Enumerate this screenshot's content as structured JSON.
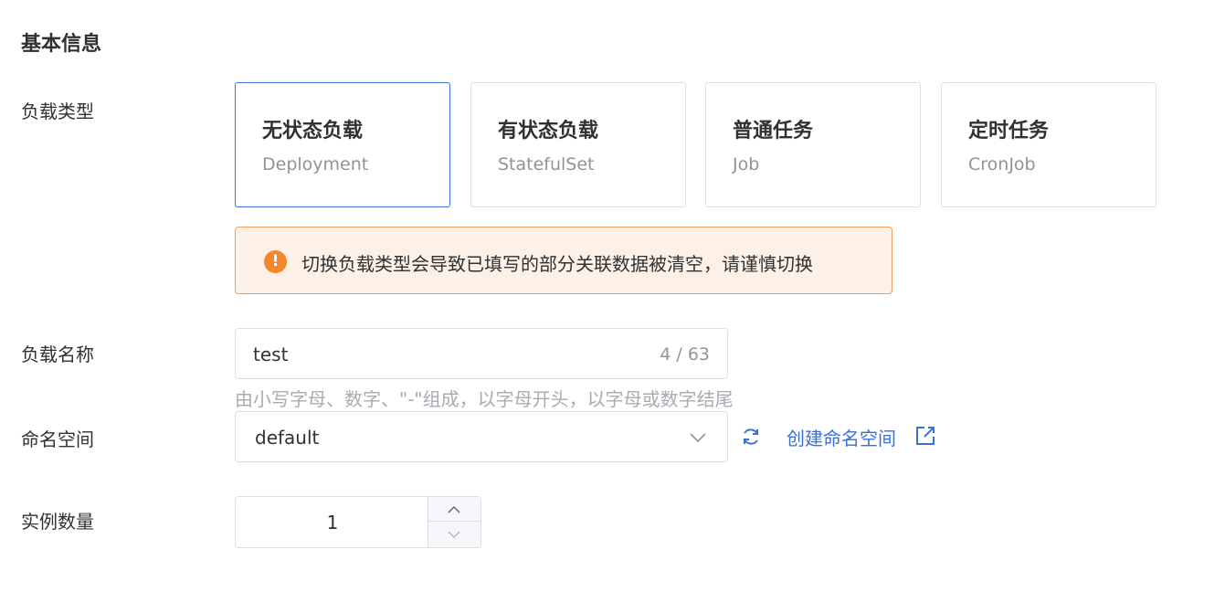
{
  "section": {
    "title": "基本信息"
  },
  "workload_type": {
    "label": "负载类型",
    "cards": [
      {
        "title": "无状态负载",
        "subtitle": "Deployment",
        "selected": true
      },
      {
        "title": "有状态负载",
        "subtitle": "StatefulSet",
        "selected": false
      },
      {
        "title": "普通任务",
        "subtitle": "Job",
        "selected": false
      },
      {
        "title": "定时任务",
        "subtitle": "CronJob",
        "selected": false
      }
    ]
  },
  "alert": {
    "icon": "warning-icon",
    "icon_glyph": "!",
    "text": "切换负载类型会导致已填写的部分关联数据被清空，请谨慎切换",
    "color": "#f5862a"
  },
  "workload_name": {
    "label": "负载名称",
    "value": "test",
    "count": "4 / 63",
    "hint": "由小写字母、数字、\"-\"组成，以字母开头，以字母或数字结尾"
  },
  "namespace": {
    "label": "命名空间",
    "value": "default",
    "refresh_icon": "refresh-icon",
    "create_link": "创建命名空间",
    "external_icon": "external-link-icon"
  },
  "replicas": {
    "label": "实例数量",
    "value": "1"
  },
  "colors": {
    "accent": "#3a6fd8",
    "warning": "#f5862a",
    "warning_bg": "#fdf1e7"
  }
}
